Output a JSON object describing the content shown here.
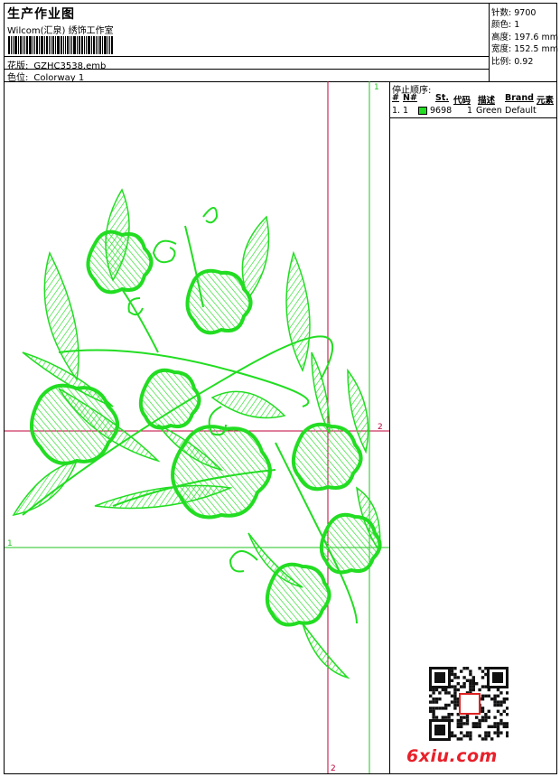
{
  "header": {
    "title": "生产作业图",
    "studio": "Wilcom(汇泉) 绣饰工作室",
    "design_label": "花版:",
    "design_value": "GZHC3538.emb",
    "color_label": "色位:",
    "color_value": "Colorway 1"
  },
  "stats": {
    "stitches_label": "针数:",
    "stitches_value": "9700",
    "colors_label": "颜色:",
    "colors_value": "1",
    "height_label": "高度:",
    "height_value": "197.6 mm",
    "width_label": "宽度:",
    "width_value": "152.5 mm",
    "scale_label": "比例:",
    "scale_value": "0.92"
  },
  "stop_sequence": {
    "title": "停止顺序:",
    "columns": [
      "#",
      "N#",
      "St.",
      "代码",
      "描述",
      "Brand",
      "元素"
    ],
    "rows": [
      {
        "index": "1.",
        "needle": "1",
        "code": "9698",
        "stitches": "1",
        "desc": "Green",
        "brand": "Default",
        "swatch": "#22dd22"
      }
    ]
  },
  "guides": {
    "top_right_label": "1",
    "mid_right_label": "2",
    "left_label": "1",
    "bottom_label": "2"
  },
  "colors": {
    "thread": "#22dd22",
    "guide_red": "#c0003a",
    "guide_green": "#22c422",
    "watermark": "#e8202a"
  },
  "watermark": {
    "text": "6xiu.com"
  }
}
